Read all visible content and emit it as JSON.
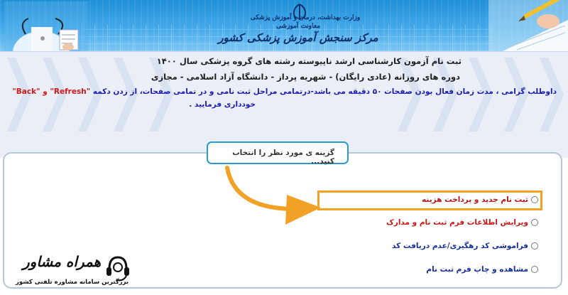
{
  "header": {
    "ministry_line1": "وزارت بهداشت، درمان و آموزش پزشکی",
    "ministry_line2": "معاونت آموزشی",
    "center_title": "مرکز سنجش آموزش پزشکی کشور"
  },
  "info": {
    "line1": "ثبت نام آزمون کارشناسی ارشد ناپیوسته رشته های گروه پزشکی سال ۱۴۰۰",
    "line2": "دوره های روزانه (عادی رایگان) - شهریه پرداز - دانشگاه آزاد اسلامی - مجازی",
    "line3_text": "داوطلب گرامی ، مدت زمان فعال بودن صفحات ۵۰ دقیقه می باشد-درتمامی مراحل ثبت نامی و در تمامی صفحات، از زدن دکمه",
    "line3_refresh": "\"Refresh\"",
    "line3_sep": "و",
    "line3_back": "\"Back\"",
    "line4": "خودداری فرمایید ."
  },
  "choose": {
    "label": "گزینه ی مورد نظر را انتخاب کنید..."
  },
  "options": [
    {
      "label": "ثبت نام جدید و پرداخت هزینه"
    },
    {
      "label": "ویرایش اطلاعات فرم ثبت نام و مدارک"
    },
    {
      "label": "فراموشی کد رهگیری/عدم دریافت کد"
    },
    {
      "label": "مشاهده و چاپ فرم ثبت نام"
    }
  ],
  "watermark": {
    "brand": "همراه مشاور",
    "tagline": "بزرگترین سامانه مشاوره تلفنی کشور"
  },
  "colors": {
    "header_blue": "#2f9fe3",
    "highlight_orange": "#f1a226",
    "option_red": "#c81818",
    "option_blue": "#15309a"
  }
}
